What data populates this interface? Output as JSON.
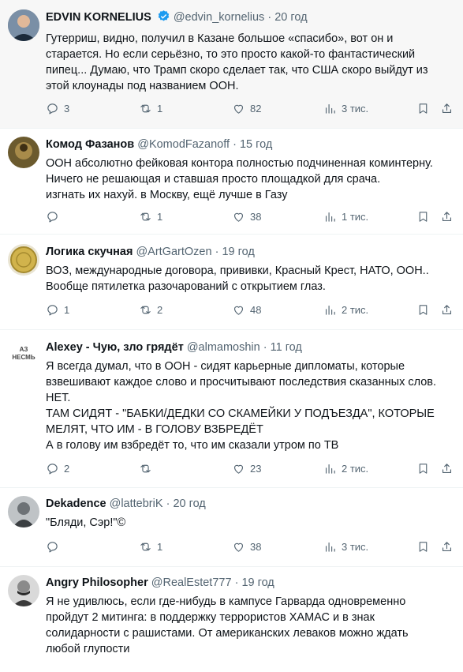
{
  "tweets": [
    {
      "name": "EDVIN KORNELIUS",
      "verified": true,
      "handle": "@edvin_kornelius",
      "time": "20 год",
      "text": "Гутерриш, видно, получил в Казане большое «спасибо», вот он и\nстарается. Но если серьёзно, то это просто какой-то фантастический\nпипец... Думаю, что Трамп скоро сделает так, что США скоро выйдут из\nэтой клоунады под названием ООН.",
      "replies": "3",
      "retweets": "1",
      "likes": "82",
      "views": "3 тис."
    },
    {
      "name": "Комод Фазанов",
      "handle": "@KomodFazanoff",
      "time": "15 год",
      "text": "ООН абсолютно фейковая контора полностью подчиненная коминтерну.\nНичего не решающая и ставшая просто площадкой для срача.\nизгнать их нахуй. в Москву, ещё лучше в Газу",
      "replies": "",
      "retweets": "1",
      "likes": "38",
      "views": "1 тис."
    },
    {
      "name": "Логика скучная",
      "handle": "@ArtGartOzen",
      "time": "19 год",
      "text": "ВОЗ, международные договора, прививки, Красный Крест, НАТО, ООН..\nВообще пятилетка разочарований с открытием глаз.",
      "replies": "1",
      "retweets": "2",
      "likes": "48",
      "views": "2 тис."
    },
    {
      "name": "Alexey - Чую, зло грядёт",
      "handle": "@almamoshin",
      "time": "11 год",
      "avatar_text": "АЗ\nНЕСМЬ",
      "text": "Я всегда думал, что в ООН - сидят карьерные дипломаты, которые\nвзвешивают каждое слово и просчитывают последствия сказанных слов.\nНЕТ.\nТАМ СИДЯТ - \"БАБКИ/ДЕДКИ СО СКАМЕЙКИ У ПОДЪЕЗДА\", КОТОРЫЕ\nМЕЛЯТ, ЧТО ИМ - В ГОЛОВУ ВЗБРЕДЁТ\nА в голову им взбредёт то, что им сказали утром по ТВ",
      "replies": "2",
      "retweets": "",
      "likes": "23",
      "views": "2 тис."
    },
    {
      "name": "Dekadence",
      "handle": "@lattebriK",
      "time": "20 год",
      "text": "\"Бляди, Сэр!\"©",
      "replies": "",
      "retweets": "1",
      "likes": "38",
      "views": "3 тис."
    },
    {
      "name": "Angry Philosopher",
      "handle": "@RealEstet777",
      "time": "19 год",
      "text": "Я не удивлюсь, если где-нибудь в кампусе Гарварда одновременно\nпройдут 2 митинга: в поддержку террористов ХАМАС и в знак\nсолидарности с рашистами. От американских леваков можно ждать\nлюбой глупости"
    }
  ],
  "separator": "·",
  "colors": {
    "text": "#0f1419",
    "secondary": "#536471",
    "verified": "#1d9bf0",
    "main_bg": "#f7f7f7"
  },
  "icons": [
    "reply-icon",
    "retweet-icon",
    "like-icon",
    "views-icon",
    "bookmark-icon",
    "share-icon",
    "verified-icon"
  ]
}
